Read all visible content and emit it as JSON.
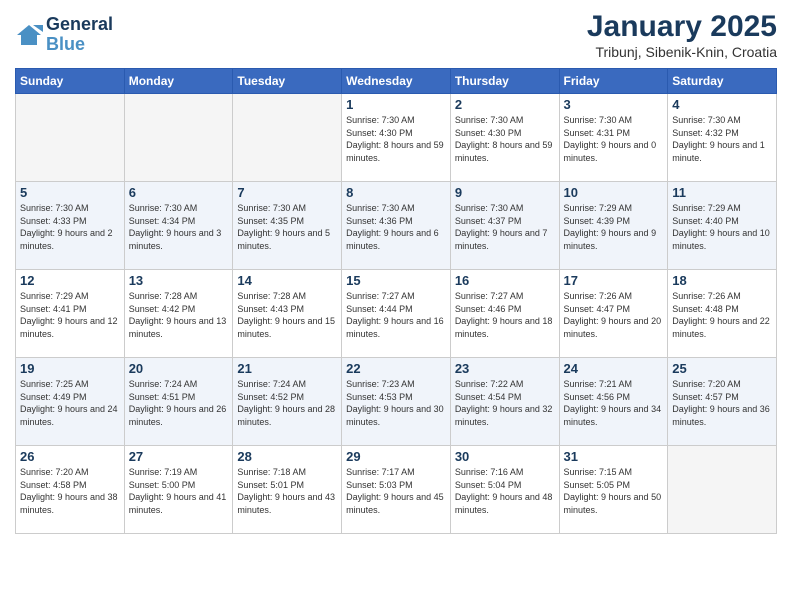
{
  "header": {
    "logo_line1": "General",
    "logo_line2": "Blue",
    "month_title": "January 2025",
    "subtitle": "Tribunj, Sibenik-Knin, Croatia"
  },
  "weekdays": [
    "Sunday",
    "Monday",
    "Tuesday",
    "Wednesday",
    "Thursday",
    "Friday",
    "Saturday"
  ],
  "weeks": [
    [
      {
        "day": "",
        "info": ""
      },
      {
        "day": "",
        "info": ""
      },
      {
        "day": "",
        "info": ""
      },
      {
        "day": "1",
        "info": "Sunrise: 7:30 AM\nSunset: 4:30 PM\nDaylight: 8 hours and 59 minutes."
      },
      {
        "day": "2",
        "info": "Sunrise: 7:30 AM\nSunset: 4:30 PM\nDaylight: 8 hours and 59 minutes."
      },
      {
        "day": "3",
        "info": "Sunrise: 7:30 AM\nSunset: 4:31 PM\nDaylight: 9 hours and 0 minutes."
      },
      {
        "day": "4",
        "info": "Sunrise: 7:30 AM\nSunset: 4:32 PM\nDaylight: 9 hours and 1 minute."
      }
    ],
    [
      {
        "day": "5",
        "info": "Sunrise: 7:30 AM\nSunset: 4:33 PM\nDaylight: 9 hours and 2 minutes."
      },
      {
        "day": "6",
        "info": "Sunrise: 7:30 AM\nSunset: 4:34 PM\nDaylight: 9 hours and 3 minutes."
      },
      {
        "day": "7",
        "info": "Sunrise: 7:30 AM\nSunset: 4:35 PM\nDaylight: 9 hours and 5 minutes."
      },
      {
        "day": "8",
        "info": "Sunrise: 7:30 AM\nSunset: 4:36 PM\nDaylight: 9 hours and 6 minutes."
      },
      {
        "day": "9",
        "info": "Sunrise: 7:30 AM\nSunset: 4:37 PM\nDaylight: 9 hours and 7 minutes."
      },
      {
        "day": "10",
        "info": "Sunrise: 7:29 AM\nSunset: 4:39 PM\nDaylight: 9 hours and 9 minutes."
      },
      {
        "day": "11",
        "info": "Sunrise: 7:29 AM\nSunset: 4:40 PM\nDaylight: 9 hours and 10 minutes."
      }
    ],
    [
      {
        "day": "12",
        "info": "Sunrise: 7:29 AM\nSunset: 4:41 PM\nDaylight: 9 hours and 12 minutes."
      },
      {
        "day": "13",
        "info": "Sunrise: 7:28 AM\nSunset: 4:42 PM\nDaylight: 9 hours and 13 minutes."
      },
      {
        "day": "14",
        "info": "Sunrise: 7:28 AM\nSunset: 4:43 PM\nDaylight: 9 hours and 15 minutes."
      },
      {
        "day": "15",
        "info": "Sunrise: 7:27 AM\nSunset: 4:44 PM\nDaylight: 9 hours and 16 minutes."
      },
      {
        "day": "16",
        "info": "Sunrise: 7:27 AM\nSunset: 4:46 PM\nDaylight: 9 hours and 18 minutes."
      },
      {
        "day": "17",
        "info": "Sunrise: 7:26 AM\nSunset: 4:47 PM\nDaylight: 9 hours and 20 minutes."
      },
      {
        "day": "18",
        "info": "Sunrise: 7:26 AM\nSunset: 4:48 PM\nDaylight: 9 hours and 22 minutes."
      }
    ],
    [
      {
        "day": "19",
        "info": "Sunrise: 7:25 AM\nSunset: 4:49 PM\nDaylight: 9 hours and 24 minutes."
      },
      {
        "day": "20",
        "info": "Sunrise: 7:24 AM\nSunset: 4:51 PM\nDaylight: 9 hours and 26 minutes."
      },
      {
        "day": "21",
        "info": "Sunrise: 7:24 AM\nSunset: 4:52 PM\nDaylight: 9 hours and 28 minutes."
      },
      {
        "day": "22",
        "info": "Sunrise: 7:23 AM\nSunset: 4:53 PM\nDaylight: 9 hours and 30 minutes."
      },
      {
        "day": "23",
        "info": "Sunrise: 7:22 AM\nSunset: 4:54 PM\nDaylight: 9 hours and 32 minutes."
      },
      {
        "day": "24",
        "info": "Sunrise: 7:21 AM\nSunset: 4:56 PM\nDaylight: 9 hours and 34 minutes."
      },
      {
        "day": "25",
        "info": "Sunrise: 7:20 AM\nSunset: 4:57 PM\nDaylight: 9 hours and 36 minutes."
      }
    ],
    [
      {
        "day": "26",
        "info": "Sunrise: 7:20 AM\nSunset: 4:58 PM\nDaylight: 9 hours and 38 minutes."
      },
      {
        "day": "27",
        "info": "Sunrise: 7:19 AM\nSunset: 5:00 PM\nDaylight: 9 hours and 41 minutes."
      },
      {
        "day": "28",
        "info": "Sunrise: 7:18 AM\nSunset: 5:01 PM\nDaylight: 9 hours and 43 minutes."
      },
      {
        "day": "29",
        "info": "Sunrise: 7:17 AM\nSunset: 5:03 PM\nDaylight: 9 hours and 45 minutes."
      },
      {
        "day": "30",
        "info": "Sunrise: 7:16 AM\nSunset: 5:04 PM\nDaylight: 9 hours and 48 minutes."
      },
      {
        "day": "31",
        "info": "Sunrise: 7:15 AM\nSunset: 5:05 PM\nDaylight: 9 hours and 50 minutes."
      },
      {
        "day": "",
        "info": ""
      }
    ]
  ]
}
